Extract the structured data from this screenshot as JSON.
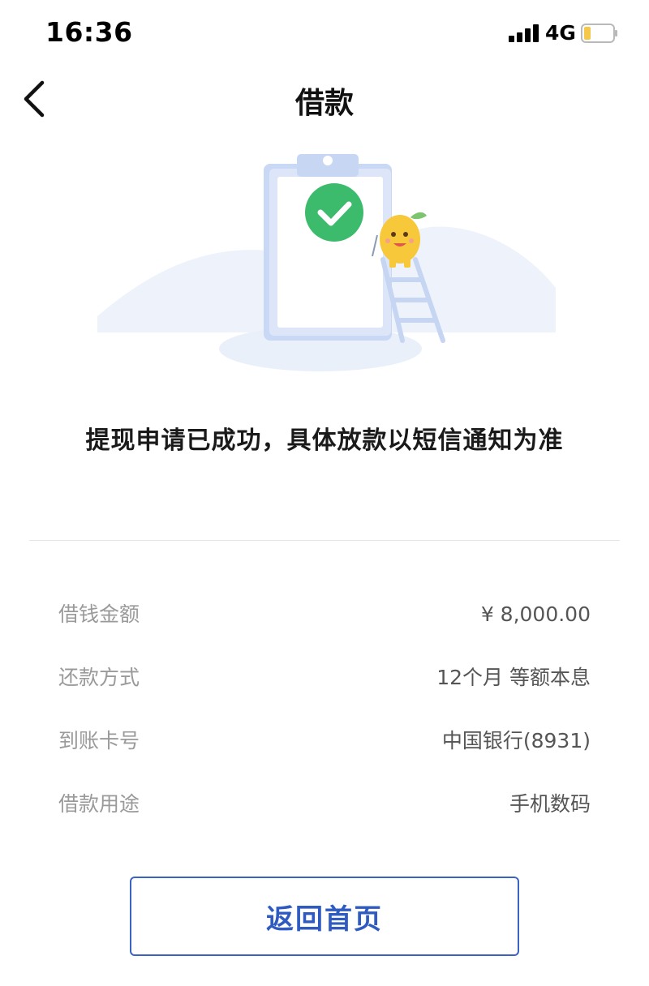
{
  "status_bar": {
    "time": "16:36",
    "network": "4G"
  },
  "nav": {
    "title": "借款"
  },
  "result": {
    "message": "提现申请已成功，具体放款以短信通知为准"
  },
  "details": [
    {
      "label": "借钱金额",
      "value": "¥ 8,000.00"
    },
    {
      "label": "还款方式",
      "value": "12个月 等额本息"
    },
    {
      "label": "到账卡号",
      "value": "中国银行(8931)"
    },
    {
      "label": "借款用途",
      "value": "手机数码"
    }
  ],
  "actions": {
    "home_label": "返回首页"
  },
  "colors": {
    "accent": "#2f5bc0",
    "success": "#3dbb6c",
    "mascot": "#f7c83a",
    "battery_fill": "#f5c84a"
  },
  "icons": {
    "back": "chevron-left-icon",
    "success": "check-circle-icon"
  }
}
